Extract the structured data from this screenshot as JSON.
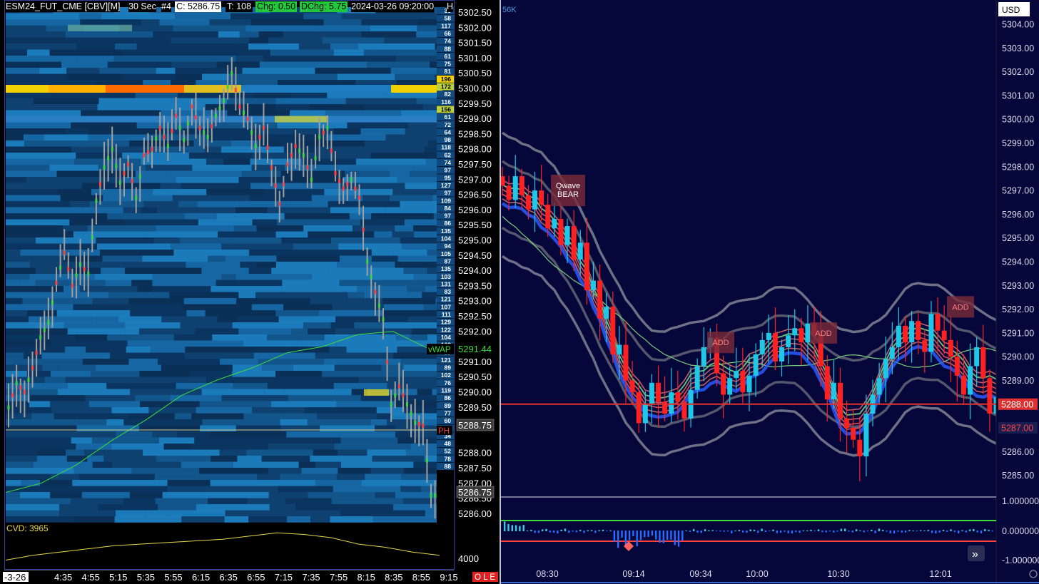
{
  "left_chart": {
    "header": {
      "symbol": "ESM24_FUT_CME [CBV][M]",
      "interval": "30 Sec",
      "bar_num": "#4",
      "close": "C: 5286.75",
      "ticks": "T: 108",
      "chg": "Chg: 0.50",
      "dchg": "DChg: 5.75",
      "datetime": "2024-03-26 09:20:00",
      "trailing": "H"
    },
    "price_labels": [
      "5302.50",
      "5302.00",
      "5301.50",
      "5301.00",
      "5300.50",
      "5300.00",
      "5299.50",
      "5299.00",
      "5298.50",
      "5298.00",
      "5297.50",
      "5297.00",
      "5296.50",
      "5296.00",
      "5295.50",
      "5295.00",
      "5294.50",
      "5294.00",
      "5293.50",
      "5293.00",
      "5292.50",
      "5292.00",
      "5291.00",
      "5290.50",
      "5290.00",
      "5289.50",
      "5288.00",
      "5287.50",
      "5287.00",
      "5286.50",
      "5286.00"
    ],
    "vwap_tag": "vWAP",
    "vwap_value": "5291.44",
    "ph_tag": "PH",
    "ph_value": "5288.75",
    "last_value": "5286.75",
    "depth_sizes": [
      "35",
      "58",
      "117",
      "66",
      "74",
      "88",
      "61",
      "75",
      "81",
      "196",
      "172",
      "82",
      "116",
      "156",
      "61",
      "72",
      "64",
      "98",
      "118",
      "62",
      "74",
      "97",
      "95",
      "127",
      "97",
      "109",
      "84",
      "97",
      "86",
      "135",
      "104",
      "94",
      "105",
      "87",
      "135",
      "103",
      "131",
      "83",
      "121",
      "107",
      "111",
      "129",
      "122",
      "104",
      "102",
      "97",
      "121",
      "89",
      "102",
      "76",
      "119",
      "86",
      "89",
      "77",
      "60",
      "67",
      "34",
      "48",
      "52",
      "78",
      "88"
    ],
    "cvd_label": "CVD: 3965",
    "cvd_axis_value": "4000",
    "time_labels": [
      "-3-26",
      "4:35",
      "4:55",
      "5:15",
      "5:35",
      "5:55",
      "6:15",
      "6:35",
      "6:55",
      "7:15",
      "7:35",
      "7:55",
      "8:15",
      "8:35",
      "8:55",
      "9:15"
    ],
    "status_flags": "O L E",
    "colors": {
      "vwap": "#3cdc3c",
      "cvd": "#e8d84a",
      "heat_base": "#0f4878",
      "wall": "#ffcc00"
    }
  },
  "right_chart": {
    "corner_label": "56K",
    "currency": "USD",
    "price_labels": [
      "5304.00",
      "5303.00",
      "5302.00",
      "5301.00",
      "5300.00",
      "5299.00",
      "5298.00",
      "5297.00",
      "5296.00",
      "5295.00",
      "5294.00",
      "5293.00",
      "5292.00",
      "5291.00",
      "5290.00",
      "5289.00",
      "5286.00",
      "5285.00"
    ],
    "line_tags": [
      {
        "value": "5288.00",
        "color": "#e03030"
      },
      {
        "value": "5287.00",
        "color": "#1a1d50"
      }
    ],
    "indicator_labels": [
      "1.000000",
      "0.000000",
      "-1.000000"
    ],
    "time_labels": [
      "08:30",
      "09:14",
      "09:34",
      "10:00",
      "10:30",
      "12:01"
    ],
    "signals": [
      {
        "label": "Qwave BEAR",
        "time": "08:30",
        "price": 5297.0
      },
      {
        "label": "ADD",
        "time": "09:34",
        "price": 5290.6
      },
      {
        "label": "ADD",
        "time": "10:30",
        "price": 5291.0
      },
      {
        "label": "ADD",
        "time": "12:01",
        "price": 5292.1
      }
    ],
    "horizontal_line": {
      "price": 5288.0,
      "color": "#e03030"
    },
    "scroll_button": "»",
    "colors": {
      "bull": "#1ec8e6",
      "bear": "#ff2020",
      "ribbon": "#ff6060",
      "wave": "#2a5cff",
      "band": "#808090"
    }
  },
  "chart_data": [
    {
      "type": "heatmap",
      "title": "ESM24_FUT_CME [CBV][M] 30 Sec",
      "y_range": [
        5285.75,
        5302.75
      ],
      "price_path": [
        5289.5,
        5290.3,
        5290.0,
        5290.8,
        5291.8,
        5292.3,
        5293.6,
        5294.6,
        5293.5,
        5294.2,
        5293.9,
        5296.3,
        5297.4,
        5298.0,
        5296.9,
        5297.5,
        5296.4,
        5297.8,
        5298.0,
        5298.7,
        5298.1,
        5299.1,
        5298.3,
        5299.4,
        5298.7,
        5298.4,
        5299.1,
        5299.6,
        5300.5,
        5299.4,
        5299.0,
        5298.1,
        5298.7,
        5297.4,
        5296.2,
        5297.5,
        5298.1,
        5297.8,
        5297.0,
        5298.4,
        5298.7,
        5297.2,
        5296.7,
        5297.0,
        5296.4,
        5294.3,
        5293.3,
        5292.4,
        5289.6,
        5290.2,
        5289.6,
        5289.0,
        5288.9,
        5286.6
      ],
      "vwap": [
        5286.7,
        5287.0,
        5287.6,
        5288.4,
        5289.1,
        5289.9,
        5290.4,
        5290.8,
        5291.3,
        5291.5,
        5291.9,
        5292.0,
        5291.44
      ],
      "cvd": [
        3890,
        3905,
        3915,
        3925,
        3935,
        3940,
        3945,
        3950,
        3955,
        3965,
        3975,
        3970,
        3960,
        3940,
        3930,
        3915,
        3905
      ],
      "liquidity_wall": {
        "price": 5300.0,
        "size": 196
      }
    },
    {
      "type": "line",
      "title": "",
      "x_labels": [
        "08:30",
        "09:14",
        "09:34",
        "10:00",
        "10:30",
        "12:01"
      ],
      "ylim": [
        5284.5,
        5304.5
      ],
      "closes": [
        5297.2,
        5296.6,
        5297.6,
        5296.8,
        5296.2,
        5297.0,
        5296.4,
        5295.4,
        5295.8,
        5294.7,
        5295.5,
        5294.1,
        5294.8,
        5292.8,
        5293.2,
        5291.6,
        5292.1,
        5290.1,
        5290.5,
        5289.0,
        5288.5,
        5287.2,
        5288.0,
        5288.9,
        5288.1,
        5287.6,
        5288.5,
        5288.1,
        5287.4,
        5288.6,
        5289.6,
        5290.4,
        5290.8,
        5289.3,
        5288.4,
        5289.1,
        5289.4,
        5288.5,
        5289.2,
        5290.1,
        5290.7,
        5291.0,
        5289.8,
        5290.4,
        5290.9,
        5291.2,
        5290.6,
        5291.4,
        5290.9,
        5289.6,
        5288.2,
        5288.9,
        5287.4,
        5287.0,
        5286.5,
        5285.8,
        5287.6,
        5288.4,
        5289.1,
        5289.9,
        5290.4,
        5291.3,
        5290.6,
        5291.5,
        5290.7,
        5290.2,
        5291.8,
        5291.1,
        5290.7,
        5290.0,
        5289.2,
        5288.4,
        5289.6,
        5290.4,
        5289.1,
        5287.6,
        5288.3
      ]
    }
  ]
}
